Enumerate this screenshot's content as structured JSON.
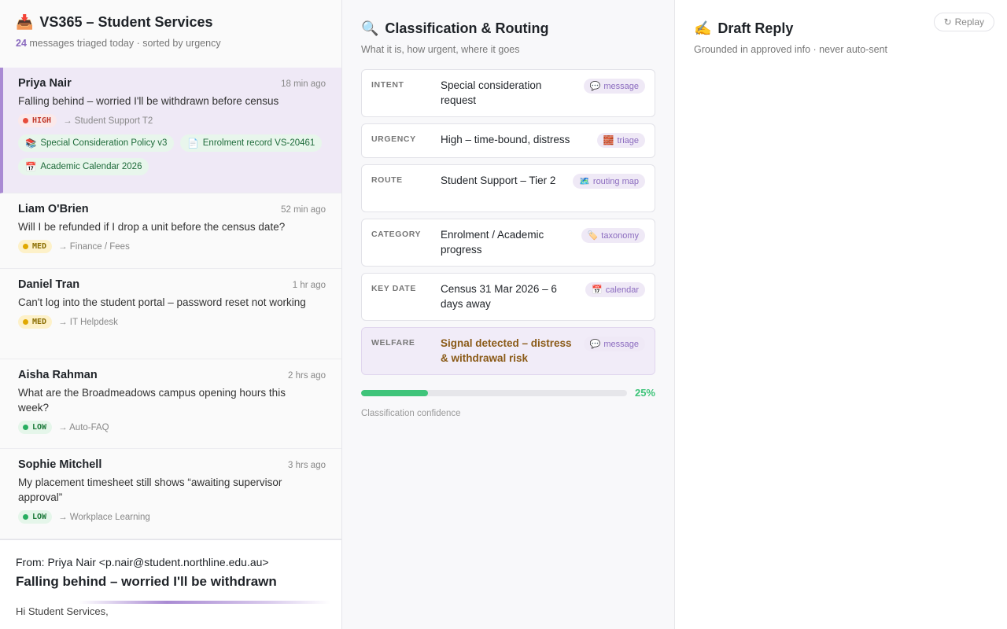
{
  "inbox": {
    "icon": "📥",
    "title": "VS365 – Student Services",
    "count": "24",
    "subtitle": "messages triaged today · sorted by urgency",
    "messages": [
      {
        "name": "Priya Nair",
        "time": "18 min ago",
        "subject": "Falling behind – worried I'll be withdrawn before census",
        "priority": "HIGH",
        "route": "→ Student Support T2",
        "sources": [
          {
            "icon": "📚",
            "label": "Special Consideration Policy v3"
          },
          {
            "icon": "📄",
            "label": "Enrolment record VS-20461"
          },
          {
            "icon": "📅",
            "label": "Academic Calendar 2026"
          }
        ]
      },
      {
        "name": "Liam O'Brien",
        "time": "52 min ago",
        "subject": "Will I be refunded if I drop a unit before the census date?",
        "priority": "MED",
        "route": "→ Finance / Fees"
      },
      {
        "name": "Daniel Tran",
        "time": "1 hr ago",
        "subject": "Can't log into the student portal – password reset not working",
        "priority": "MED",
        "route": "→ IT Helpdesk"
      },
      {
        "name": "Aisha Rahman",
        "time": "2 hrs ago",
        "subject": "What are the Broadmeadows campus opening hours this week?",
        "priority": "LOW",
        "route": "→ Auto-FAQ"
      },
      {
        "name": "Sophie Mitchell",
        "time": "3 hrs ago",
        "subject": "My placement timesheet still shows “awaiting supervisor approval”",
        "priority": "LOW",
        "route": "→ Workplace Learning"
      }
    ]
  },
  "email": {
    "from": "From: Priya Nair <p.nair@student.northline.edu.au>",
    "subject": "Falling behind – worried I'll be withdrawn",
    "greeting": "Hi Student Services,"
  },
  "classification": {
    "icon": "🔍",
    "title": "Classification & Routing",
    "subtitle": "What it is, how urgent, where it goes",
    "fields": [
      {
        "key": "INTENT",
        "value": "Special consideration request",
        "source_icon": "💬",
        "source": "message"
      },
      {
        "key": "URGENCY",
        "value": "High – time-bound, distress",
        "source_icon": "🧱",
        "source": "triage"
      },
      {
        "key": "ROUTE",
        "value": "Student Support – Tier 2",
        "source_icon": "🗺️",
        "source": "routing map"
      },
      {
        "key": "CATEGORY",
        "value": "Enrolment / Academic progress",
        "source_icon": "🏷️",
        "source": "taxonomy"
      },
      {
        "key": "KEY DATE",
        "value": "Census 31 Mar 2026 – 6 days away",
        "source_icon": "📅",
        "source": "calendar"
      },
      {
        "key": "WELFARE",
        "value": "Signal detected – distress & withdrawal risk",
        "source_icon": "💬",
        "source": "message"
      }
    ],
    "confidence_value": 0.25,
    "confidence_text": "25%",
    "confidence_label": "Classification confidence",
    "color_conf": "#3fc47a"
  },
  "draft": {
    "icon": "✍️",
    "title": "Draft Reply",
    "subtitle": "Grounded in approved info · never auto-sent",
    "replay_icon": "↻",
    "replay_label": "Replay"
  }
}
